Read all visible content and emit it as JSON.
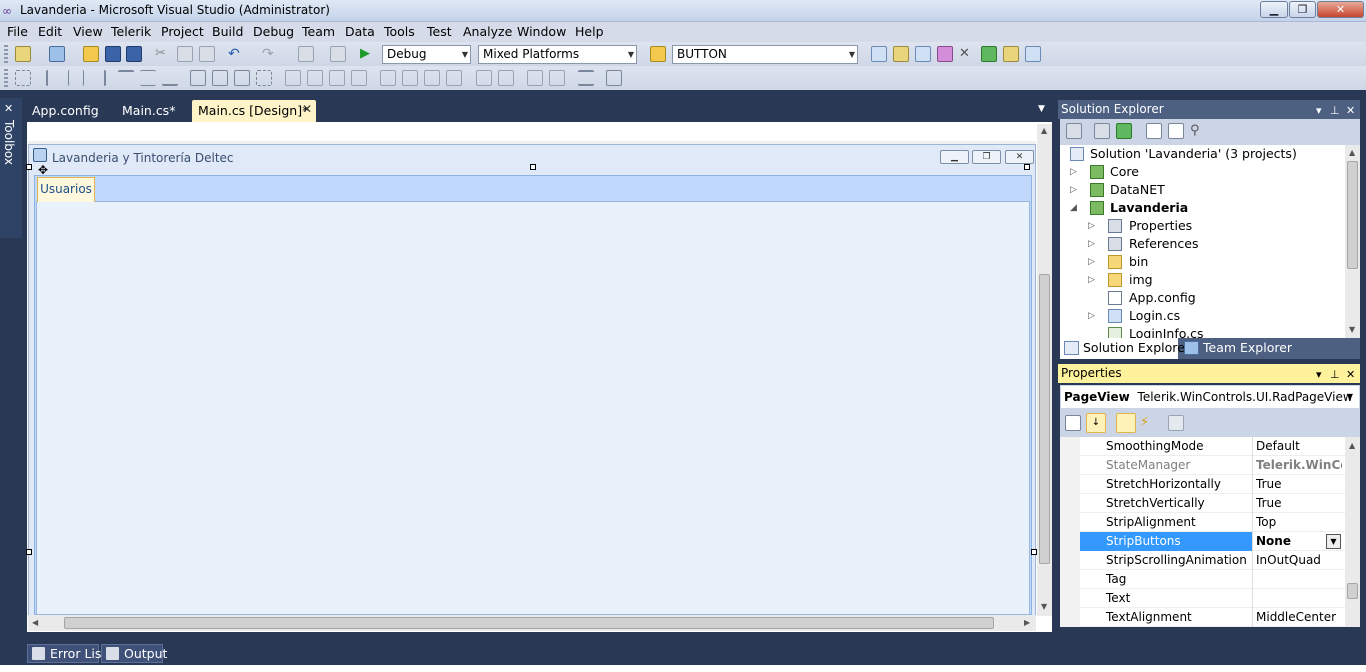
{
  "window": {
    "title": "Lavanderia - Microsoft Visual Studio (Administrator)",
    "controls": [
      "minimize",
      "maximize",
      "close"
    ]
  },
  "menu": [
    "File",
    "Edit",
    "View",
    "Telerik",
    "Project",
    "Build",
    "Debug",
    "Team",
    "Data",
    "Tools",
    "Test",
    "Analyze",
    "Window",
    "Help"
  ],
  "toolbar": {
    "config_value": "Debug",
    "platform_value": "Mixed Platforms",
    "find_value": "BUTTON"
  },
  "toolbox": {
    "label": "Toolbox"
  },
  "doc_tabs": [
    {
      "label": "App.config"
    },
    {
      "label": "Main.cs*"
    },
    {
      "label": "Main.cs [Design]*",
      "active": true
    }
  ],
  "designer": {
    "form_title": "Lavanderia y Tintorería Deltec",
    "pageview_tab": "Usuarios"
  },
  "solution_explorer": {
    "title": "Solution Explorer",
    "root": "Solution 'Lavanderia' (3 projects)",
    "items": [
      {
        "label": "Core",
        "level": 1,
        "icon": "csharp-project-icon",
        "expander": "collapsed"
      },
      {
        "label": "DataNET",
        "level": 1,
        "icon": "csharp-project-icon",
        "expander": "collapsed"
      },
      {
        "label": "Lavanderia",
        "level": 1,
        "icon": "csharp-project-icon",
        "expander": "expanded",
        "bold": true
      },
      {
        "label": "Properties",
        "level": 2,
        "icon": "properties-icon",
        "expander": "collapsed"
      },
      {
        "label": "References",
        "level": 2,
        "icon": "references-icon",
        "expander": "collapsed"
      },
      {
        "label": "bin",
        "level": 2,
        "icon": "folder-icon",
        "expander": "collapsed"
      },
      {
        "label": "img",
        "level": 2,
        "icon": "folder-icon",
        "expander": "collapsed"
      },
      {
        "label": "App.config",
        "level": 2,
        "icon": "config-file-icon",
        "expander": "none"
      },
      {
        "label": "Login.cs",
        "level": 2,
        "icon": "form-file-icon",
        "expander": "collapsed"
      },
      {
        "label": "LoginInfo.cs",
        "level": 2,
        "icon": "cs-file-icon",
        "expander": "none"
      }
    ],
    "tabs": [
      "Solution Explorer",
      "Team Explorer"
    ]
  },
  "properties": {
    "title": "Properties",
    "object_name": "PageView",
    "object_type": "Telerik.WinControls.UI.RadPageView",
    "rows": [
      {
        "name": "SmoothingMode",
        "value": "Default"
      },
      {
        "name": "StateManager",
        "value": "Telerik.WinCon",
        "gray": true
      },
      {
        "name": "StretchHorizontally",
        "value": "True"
      },
      {
        "name": "StretchVertically",
        "value": "True"
      },
      {
        "name": "StripAlignment",
        "value": "Top"
      },
      {
        "name": "StripButtons",
        "value": "None",
        "selected": true
      },
      {
        "name": "StripScrollingAnimation",
        "value": "InOutQuad"
      },
      {
        "name": "Tag",
        "value": ""
      },
      {
        "name": "Text",
        "value": ""
      },
      {
        "name": "TextAlignment",
        "value": "MiddleCenter"
      }
    ]
  },
  "bottom_tabs": [
    "Error List",
    "Output"
  ]
}
